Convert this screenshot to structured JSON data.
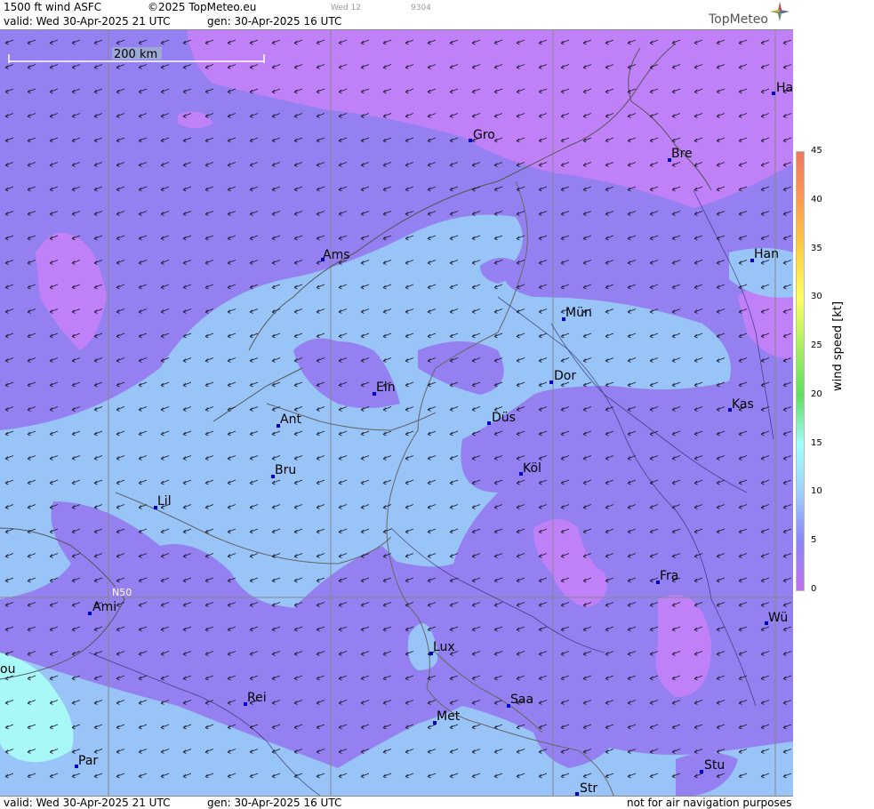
{
  "header": {
    "product": "1500 ft wind ASFC",
    "copyright": "©2025 TopMeteo.eu",
    "valid": "valid:  Wed  30-Apr-2025  21 UTC",
    "generated": "gen: 30-Apr-2025 16 UTC",
    "small_a": "Wed 12",
    "small_b": "9304",
    "logo": "TopMeteo"
  },
  "footer": {
    "valid": "valid:  Wed  30-Apr-2025  21 UTC",
    "generated": "gen: 30-Apr-2025 16 UTC",
    "disclaimer": "not for air navigation purposes"
  },
  "map": {
    "scale_label": "200 km",
    "lat_label": "N50",
    "cities": [
      {
        "name": "Ha"
      },
      {
        "name": "Gro"
      },
      {
        "name": "Bre"
      },
      {
        "name": "Ams"
      },
      {
        "name": "Han"
      },
      {
        "name": "Mün"
      },
      {
        "name": "Ein"
      },
      {
        "name": "Dor"
      },
      {
        "name": "Ant"
      },
      {
        "name": "Düs"
      },
      {
        "name": "Kas"
      },
      {
        "name": "Bru"
      },
      {
        "name": "Köl"
      },
      {
        "name": "Lil"
      },
      {
        "name": "Fra"
      },
      {
        "name": "Ami"
      },
      {
        "name": "Wü"
      },
      {
        "name": "Lux"
      },
      {
        "name": "ou"
      },
      {
        "name": "Rei"
      },
      {
        "name": "Saa"
      },
      {
        "name": "Met"
      },
      {
        "name": "Par"
      },
      {
        "name": "Stu"
      },
      {
        "name": "Str"
      }
    ]
  },
  "legend": {
    "unit_label": "wind  speed  [kt]",
    "ticks": [
      "45",
      "40",
      "35",
      "30",
      "25",
      "20",
      "15",
      "10",
      "5",
      "0"
    ],
    "colors": [
      "#f07860",
      "#ff9a50",
      "#ffd040",
      "#ffff60",
      "#a8f060",
      "#60e060",
      "#a0ffff",
      "#9cd0ff",
      "#8c84f8",
      "#c070f0"
    ]
  },
  "colors": {
    "band_0_5": "#c080f8",
    "band_5_10": "#9480f0",
    "band_10_15": "#98c4f8",
    "band_15_20": "#a8f8f8"
  }
}
